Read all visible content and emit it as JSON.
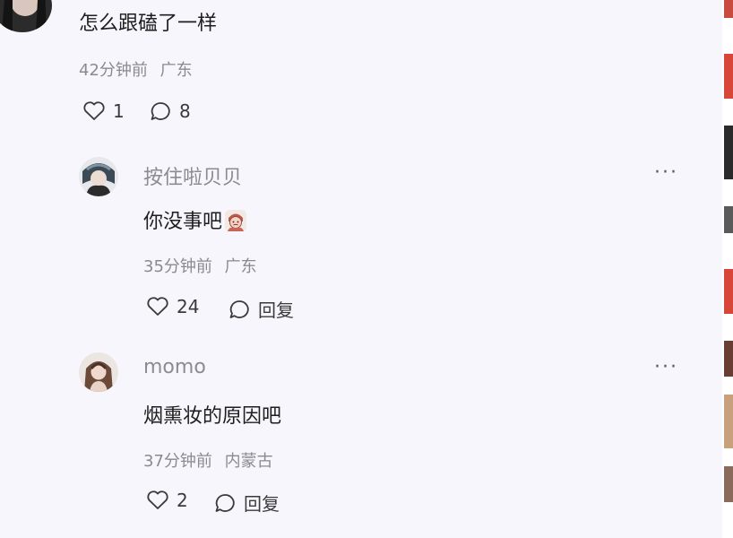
{
  "top_comment": {
    "text": "怎么跟磕了一样",
    "time": "42分钟前",
    "location": "广东",
    "likes": "1",
    "replies": "8"
  },
  "replies": [
    {
      "username": "按住啦贝贝",
      "text": "你没事吧",
      "emoji_icon": "face-sticker-icon",
      "time": "35分钟前",
      "location": "广东",
      "likes": "24",
      "reply_label": "回复",
      "more": "···"
    },
    {
      "username": "momo",
      "text": "烟熏妆的原因吧",
      "time": "37分钟前",
      "location": "内蒙古",
      "likes": "2",
      "reply_label": "回复",
      "more": "···"
    }
  ],
  "colors": {
    "background": "#f7f6fc",
    "meta_text": "#8a8a8f",
    "username_text": "#8b8b92"
  }
}
